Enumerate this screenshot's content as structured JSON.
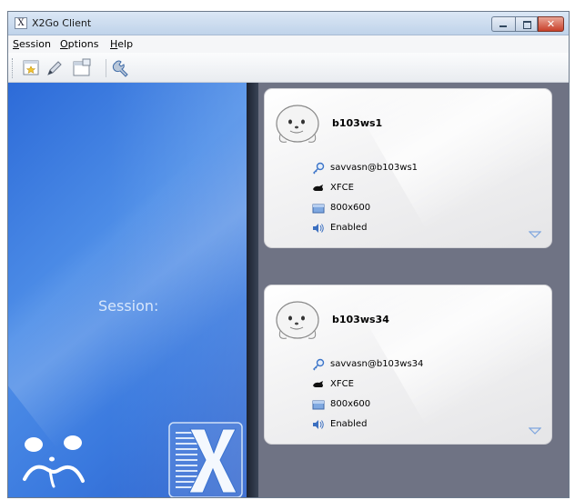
{
  "window": {
    "title": "X2Go Client"
  },
  "menu": [
    {
      "accel": "S",
      "rest": "ession"
    },
    {
      "accel": "O",
      "rest": "ptions"
    },
    {
      "accel": "H",
      "rest": "elp"
    }
  ],
  "toolbar": {
    "icons": [
      "new-session-icon",
      "edit-session-icon",
      "session-manager-icon",
      "settings-wrench-icon"
    ]
  },
  "left_panel": {
    "label": "Session:"
  },
  "sessions": [
    {
      "name": "b103ws1",
      "login": "savvasn@b103ws1",
      "desktop": "XFCE",
      "resolution": "800x600",
      "sound": "Enabled"
    },
    {
      "name": "b103ws34",
      "login": "savvasn@b103ws34",
      "desktop": "XFCE",
      "resolution": "800x600",
      "sound": "Enabled"
    }
  ],
  "colors": {
    "left_panel": "#3a79de",
    "right_panel": "#6f7384",
    "card": "#f3f3f4",
    "accent_arrow": "#8fb4e6"
  }
}
